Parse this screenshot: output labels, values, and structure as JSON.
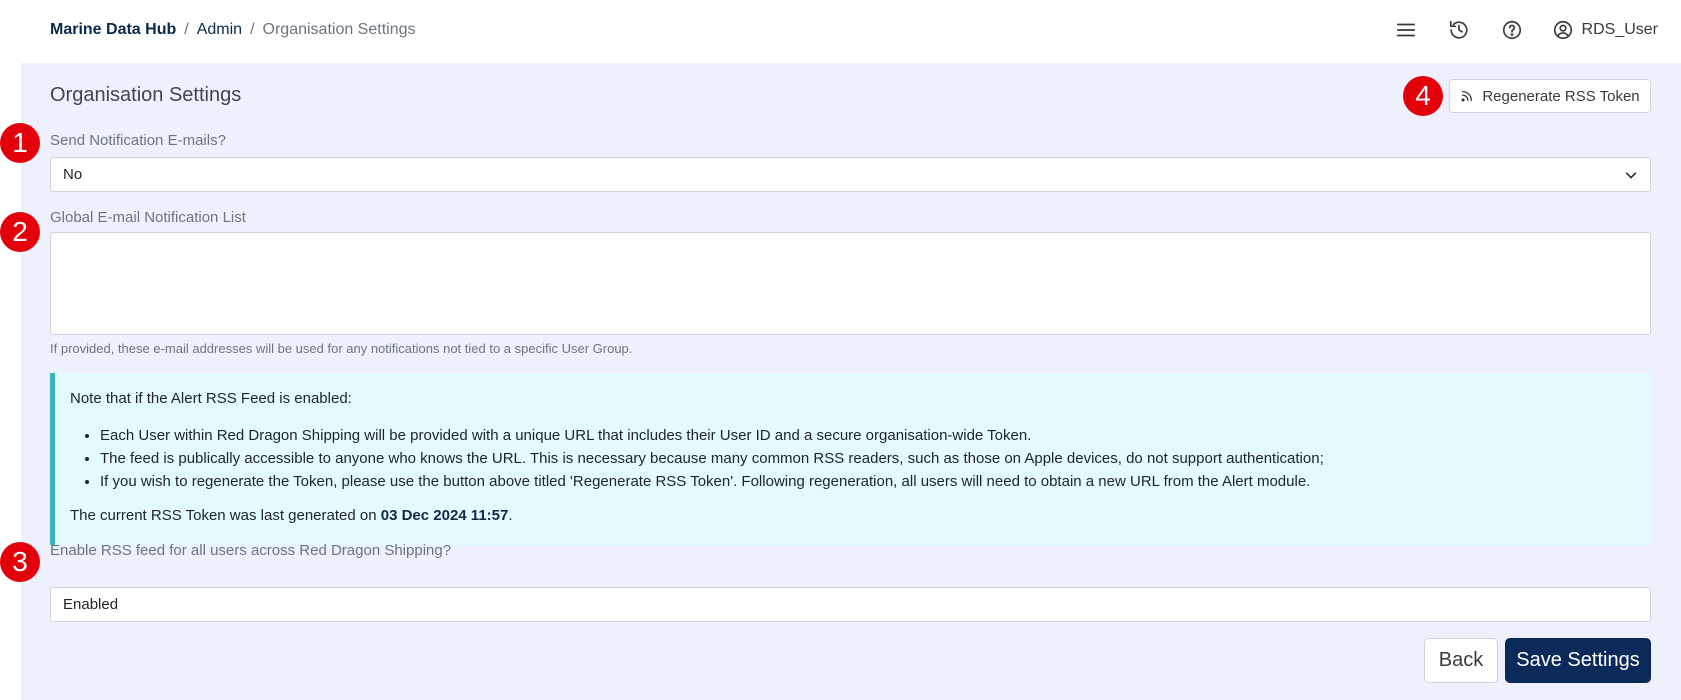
{
  "breadcrumb": {
    "home": "Marine Data Hub",
    "separator": "/",
    "admin": "Admin",
    "current": "Organisation Settings"
  },
  "header": {
    "icons": [
      "menu-icon",
      "history-icon",
      "help-icon",
      "user-circle-icon"
    ],
    "username": "RDS_User"
  },
  "page": {
    "title": "Organisation Settings",
    "rss_button_label": "Regenerate RSS Token"
  },
  "markers": [
    "1",
    "2",
    "3",
    "4"
  ],
  "form": {
    "send_notifications_label": "Send Notification E-mails?",
    "send_notifications_value": "No",
    "global_list_label": "Global E-mail Notification List",
    "global_list_value": "",
    "global_list_help": "If provided, these e-mail addresses will be used for any notifications not tied to a specific User Group.",
    "rss_label": "Enable RSS feed for all users across Red Dragon Shipping?",
    "rss_value": "Enabled"
  },
  "note": {
    "intro": "Note that if the Alert RSS Feed is enabled:",
    "bullets": [
      "Each User within Red Dragon Shipping will be provided with a unique URL that includes their User ID and a secure organisation-wide Token.",
      "The feed is publically accessible to anyone who knows the URL. This is necessary because many common RSS readers, such as those on Apple devices, do not support authentication;",
      "If you wish to regenerate the Token, please use the button above titled 'Regenerate RSS Token'. Following regeneration, all users will need to obtain a new URL from the Alert module."
    ],
    "last_prefix": "The current RSS Token was last generated on ",
    "last_date": "03 Dec 2024 11:57",
    "last_suffix": "."
  },
  "actions": {
    "back": "Back",
    "save": "Save Settings"
  },
  "colors": {
    "brand_navy": "#0b2a5a",
    "marker_red": "#e3000b",
    "panel_bg": "#eef1fc",
    "note_bg": "#e4fbfd",
    "note_border": "#36b5bf"
  }
}
